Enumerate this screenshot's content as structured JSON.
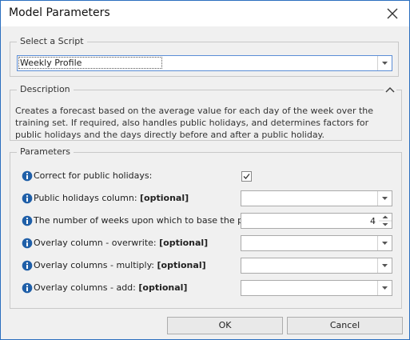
{
  "window": {
    "title": "Model Parameters"
  },
  "script_group": {
    "label": "Select a Script",
    "selected": "Weekly Profile"
  },
  "description_group": {
    "label": "Description",
    "text": "Creates a forecast based on the average value for each day of the week over the training set. If required, also handles public holidays, and determines factors for public holidays and the days directly before and after a public holiday."
  },
  "parameters_group": {
    "label": "Parameters",
    "rows": [
      {
        "label": "Correct for public holidays:",
        "optional": "",
        "control": "checkbox",
        "checked": true
      },
      {
        "label": "Public holidays column: ",
        "optional": "[optional]",
        "control": "combo",
        "value": ""
      },
      {
        "label": "The number of weeks upon which to base the profile:",
        "optional": "",
        "control": "spin",
        "value": "4"
      },
      {
        "label": "Overlay column - overwrite: ",
        "optional": "[optional]",
        "control": "combo",
        "value": ""
      },
      {
        "label": "Overlay columns - multiply: ",
        "optional": "[optional]",
        "control": "combo",
        "value": ""
      },
      {
        "label": "Overlay columns - add: ",
        "optional": "[optional]",
        "control": "combo",
        "value": ""
      }
    ]
  },
  "buttons": {
    "ok": "OK",
    "cancel": "Cancel"
  },
  "colors": {
    "window_border": "#2b6fbf",
    "info_icon": "#1f5fa8",
    "focus_border": "#5b8dd6"
  }
}
